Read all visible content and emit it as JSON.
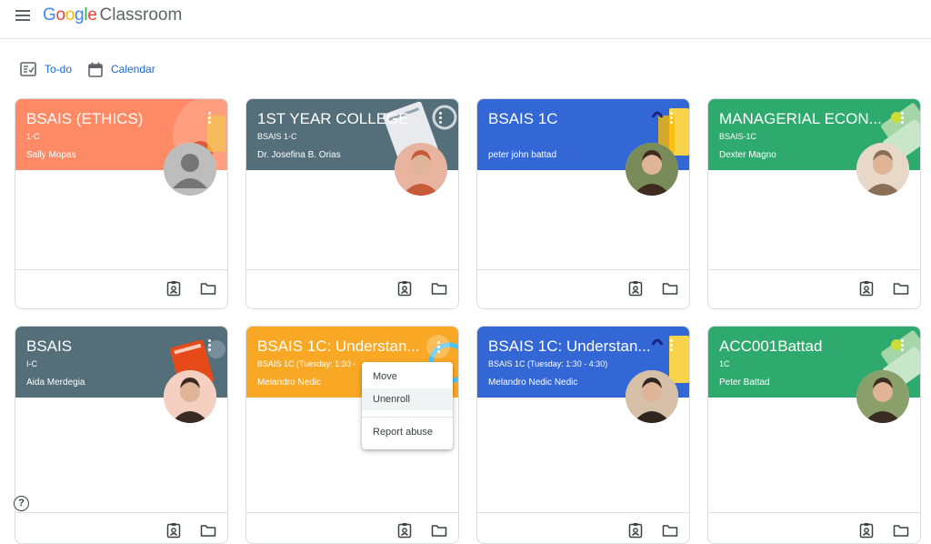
{
  "app": {
    "logo_google": "Google",
    "logo_product": "Classroom"
  },
  "subnav": {
    "todo": "To-do",
    "calendar": "Calendar"
  },
  "accent_color": "#1967d2",
  "cards": [
    {
      "title": "BSAIS (ETHICS)",
      "section": "1-C",
      "teacher": "Sally Mopas",
      "color": "#ff8a65",
      "avatar": "default-avatar"
    },
    {
      "title": "1ST YEAR COLLEGE",
      "section": "BSAIS 1-C",
      "teacher": "Dr. Josefina B. Orias",
      "color": "#546e7a",
      "avatar": "photo"
    },
    {
      "title": "BSAIS 1C",
      "section": "",
      "teacher": "peter john battad",
      "color": "#3367d6",
      "avatar": "photo"
    },
    {
      "title": "MANAGERIAL ECON...",
      "section": "BSAIS-1C",
      "teacher": "Dexter Magno",
      "color": "#2eaa6e",
      "avatar": "photo"
    },
    {
      "title": "BSAIS",
      "section": "I-C",
      "teacher": "Aida Merdegia",
      "color": "#546e7a",
      "avatar": "photo"
    },
    {
      "title": "BSAIS 1C: Understan...",
      "section": "BSAIS 1C (Tuesday: 1:30 -",
      "teacher": "Melandro Nedic",
      "color": "#f9a825",
      "avatar": "none"
    },
    {
      "title": "BSAIS 1C: Understan...",
      "section": "BSAIS 1C (Tuesday: 1:30 - 4:30)",
      "teacher": "Melandro Nedic Nedic",
      "color": "#3367d6",
      "avatar": "photo"
    },
    {
      "title": "ACC001Battad",
      "section": "1C",
      "teacher": "Peter Battad",
      "color": "#2eaa6e",
      "avatar": "photo"
    }
  ],
  "card_menu": {
    "move": "Move",
    "unenroll": "Unenroll",
    "report": "Report abuse"
  },
  "help": "?"
}
